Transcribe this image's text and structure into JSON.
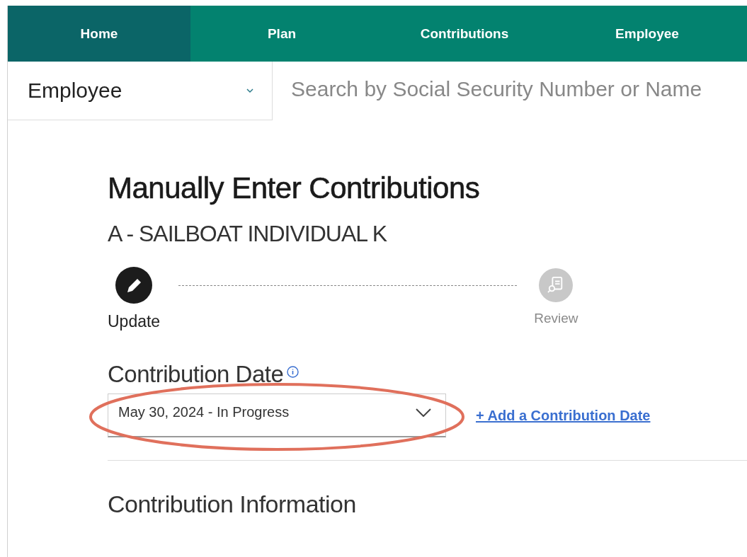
{
  "nav": {
    "tabs": [
      {
        "label": "Home",
        "selected": true
      },
      {
        "label": "Plan",
        "selected": false
      },
      {
        "label": "Contributions",
        "selected": false
      },
      {
        "label": "Employee",
        "selected": false
      }
    ]
  },
  "search_bar": {
    "scope": "Employee",
    "placeholder": "Search by Social Security Number or Name"
  },
  "page": {
    "title": "Manually Enter Contributions",
    "subtitle": "A - SAILBOAT INDIVIDUAL K"
  },
  "steps": [
    {
      "label": "Update",
      "kind": "edit",
      "selected": true
    },
    {
      "label": "Review",
      "kind": "review",
      "selected": false
    }
  ],
  "contribution_date": {
    "label": "Contribution Date",
    "value": "May 30, 2024 - In Progress",
    "link": "+ Add a Contribution Date",
    "highlighted": true
  },
  "section": {
    "title": "Contribution Information"
  }
}
